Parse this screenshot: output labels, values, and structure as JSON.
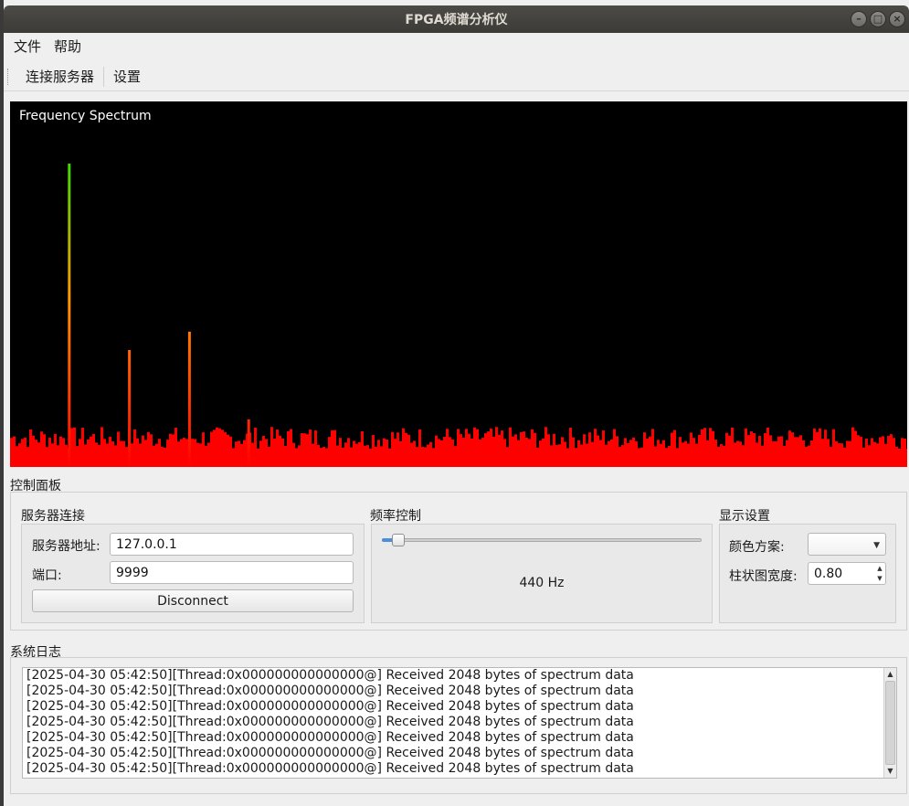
{
  "window": {
    "title": "FPGA频谱分析仪"
  },
  "menu": {
    "items": [
      "文件",
      "帮助"
    ]
  },
  "toolbar": {
    "connect_label": "连接服务器",
    "settings_label": "设置"
  },
  "spectrum": {
    "title": "Frequency Spectrum",
    "background": "#000000"
  },
  "control_panel": {
    "title": "控制面板",
    "server": {
      "title": "服务器连接",
      "address_label": "服务器地址:",
      "address_value": "127.0.0.1",
      "port_label": "端口:",
      "port_value": "9999",
      "disconnect_label": "Disconnect"
    },
    "frequency": {
      "title": "频率控制",
      "value_label": "440 Hz",
      "slider_fraction": 0.03
    },
    "display": {
      "title": "显示设置",
      "color_scheme_label": "颜色方案:",
      "color_scheme_value": "",
      "bar_width_label": "柱状图宽度:",
      "bar_width_value": "0.80"
    }
  },
  "log": {
    "title": "系统日志",
    "lines": [
      "[2025-04-30 05:42:50][Thread:0x000000000000000@] Received 2048 bytes of spectrum data",
      "[2025-04-30 05:42:50][Thread:0x000000000000000@] Received 2048 bytes of spectrum data",
      "[2025-04-30 05:42:50][Thread:0x000000000000000@] Received 2048 bytes of spectrum data",
      "[2025-04-30 05:42:50][Thread:0x000000000000000@] Received 2048 bytes of spectrum data",
      "[2025-04-30 05:42:50][Thread:0x000000000000000@] Received 2048 bytes of spectrum data",
      "[2025-04-30 05:42:50][Thread:0x000000000000000@] Received 2048 bytes of spectrum data",
      "[2025-04-30 05:42:50][Thread:0x000000000000000@] Received 2048 bytes of spectrum data"
    ]
  },
  "chart_data": {
    "type": "bar",
    "title": "Frequency Spectrum",
    "peaks": [
      {
        "bin_fraction": 0.066,
        "level": 0.83
      },
      {
        "bin_fraction": 0.133,
        "level": 0.32
      },
      {
        "bin_fraction": 0.2,
        "level": 0.37
      },
      {
        "bin_fraction": 0.266,
        "level": 0.13
      }
    ],
    "noise_floor_level": 0.05,
    "noise_variation": 0.06,
    "color_low": "#ff0000",
    "color_mid": "#ff9900",
    "color_high": "#33dd00"
  }
}
